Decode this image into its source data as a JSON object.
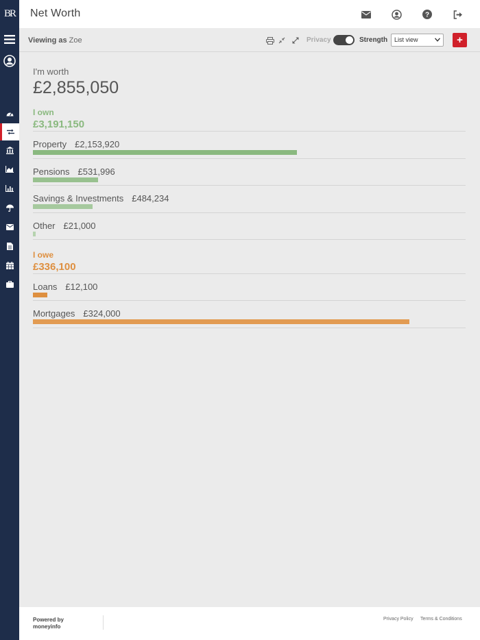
{
  "app": {
    "logo": "BR",
    "title": "Net Worth"
  },
  "toolbar": {
    "viewing_label": "Viewing as",
    "viewing_user": "Zoe",
    "privacy_label": "Privacy",
    "strength_label": "Strength",
    "view_select": "List view",
    "add_label": "+"
  },
  "summary": {
    "worth_label": "I'm worth",
    "worth_value": "£2,855,050"
  },
  "own": {
    "label": "I own",
    "total": "£3,191,150",
    "color": "#8ab97f",
    "items": [
      {
        "name": "Property",
        "amount": "£2,153,920",
        "share": 0.675,
        "color": "#8ab97f"
      },
      {
        "name": "Pensions",
        "amount": "£531,996",
        "share": 0.167,
        "color": "#98c18f"
      },
      {
        "name": "Savings & Investments",
        "amount": "£484,234",
        "share": 0.152,
        "color": "#a6c99e"
      },
      {
        "name": "Other",
        "amount": "£21,000",
        "share": 0.007,
        "color": "#b6d3af"
      }
    ]
  },
  "owe": {
    "label": "I owe",
    "total": "£336,100",
    "color": "#de8f3f",
    "items": [
      {
        "name": "Loans",
        "amount": "£12,100",
        "share": 0.036,
        "color": "#de8f3f"
      },
      {
        "name": "Mortgages",
        "amount": "£324,000",
        "share": 0.964,
        "color": "#e29b52"
      }
    ]
  },
  "footer": {
    "powered_line1": "Powered by",
    "powered_line2": "moneyinfo",
    "privacy_link": "Privacy Policy",
    "terms_link": "Terms & Conditions"
  }
}
